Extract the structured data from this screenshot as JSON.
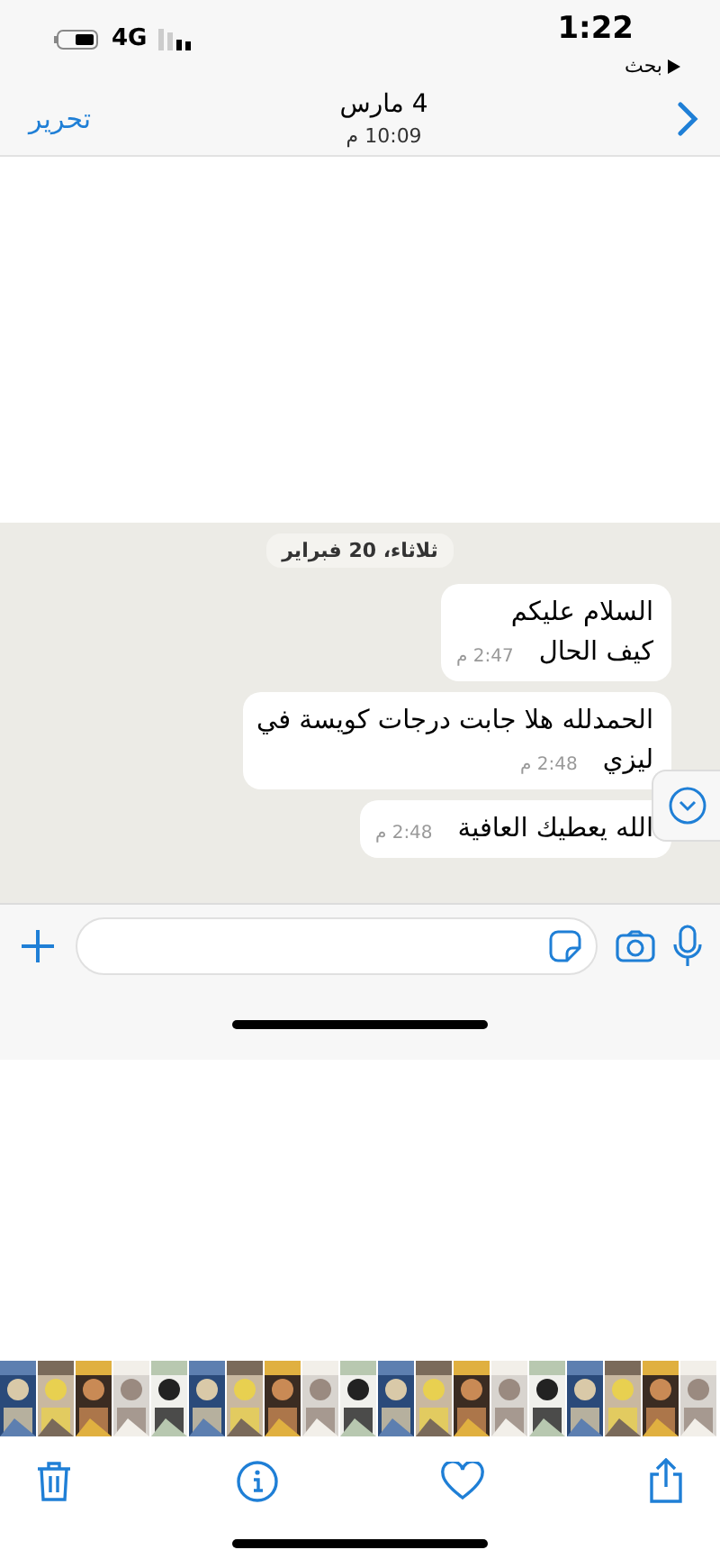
{
  "status_bar": {
    "time": "1:22",
    "back_app": "بحث",
    "network": "4G"
  },
  "nav": {
    "date": "4 مارس",
    "time": "10:09 م",
    "edit": "تحرير"
  },
  "chat": {
    "date_chip": "ثلاثاء، 20 فبراير",
    "messages": [
      {
        "lines": [
          "السلام عليكم",
          "كيف الحال"
        ],
        "time": "2:47 م"
      },
      {
        "lines": [
          "الحمدلله هلا جابت درجات كويسة في",
          "ليزي"
        ],
        "time": "2:48 م"
      },
      {
        "lines": [
          "الله يعطيك العافية"
        ],
        "time": "2:48 م"
      }
    ]
  }
}
